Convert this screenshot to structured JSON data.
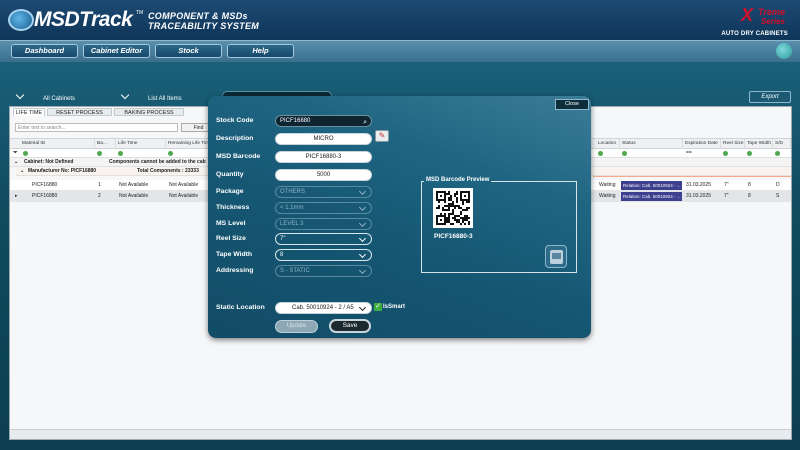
{
  "header": {
    "logo_msd": "MSD",
    "logo_track": "Track",
    "logo_tm": "TM",
    "subtitle_line1": "COMPONENT & MSDs",
    "subtitle_line2": "TRACEABILITY SYSTEM",
    "brand_x": "X",
    "brand_treme": "Treme",
    "brand_series": "Series",
    "brand_tagline": "AUTO DRY CABINETS"
  },
  "nav": {
    "items": [
      "Dashboard",
      "Cabinet Editor",
      "Stock",
      "Help"
    ]
  },
  "toolbar": {
    "all_cabinets": "All Cabinets",
    "list_all_items": "List All Items",
    "export": "Export"
  },
  "grid": {
    "tabs": [
      "LIFE TIME",
      "RESET PROCESS",
      "BAKING PROCESS"
    ],
    "filter_placeholder": "Enter text to search...",
    "find": "Find",
    "columns": [
      "Material ID",
      "Ba...",
      "Life Time",
      "Remaining Life Time",
      "Location",
      "Status",
      "Expiration Date",
      "Reel Size",
      "Tape Width",
      "S/D"
    ],
    "group1": {
      "label": "Cabinet: Not Defined",
      "note": "Components cannot be added to the cab"
    },
    "group2": {
      "label": "Manufacturer No: PICF16880",
      "total": "Total Components : 23333"
    },
    "rows": [
      {
        "material": "PICF16880",
        "ba": "1",
        "life": "Not Available",
        "remaining": "Not Available",
        "location": "Waiting",
        "status": "Relation: Cab. 50010924 - ...",
        "exp": "31.03.2025",
        "reel": "7\"",
        "tape": "8",
        "sd": "D"
      },
      {
        "material": "PICF16880",
        "ba": "2",
        "life": "Not Available",
        "remaining": "Not Available",
        "location": "Waiting",
        "status": "Relation: Cab. 50010924 - ...",
        "exp": "31.03.2025",
        "reel": "7\"",
        "tape": "8",
        "sd": "S"
      }
    ],
    "filter_exp": "=="
  },
  "modal": {
    "close": "Close",
    "labels": {
      "stock_code": "Stock Code",
      "description": "Description",
      "msd_barcode": "MSD Barcode",
      "quantity": "Quantity",
      "package": "Package",
      "thickness": "Thickness",
      "ms_level": "MS Level",
      "reel_size": "Reel Size",
      "tape_width": "Tape Width",
      "addressing": "Addressing",
      "static_location": "Static Location"
    },
    "values": {
      "stock_code": "PICF16880",
      "description": "MICRO",
      "msd_barcode": "PICF16880-3",
      "quantity": "5000",
      "package": "OTHERS",
      "thickness": "< 1.1mm",
      "ms_level": "LEVEL 3",
      "reel_size": "7\"",
      "tape_width": "8",
      "addressing": "S - STATIC",
      "static_location": "Cab. 50010924 - 2 / A5"
    },
    "preview_title": "MSD Barcode Preview",
    "qr_caption": "PICF16880-3",
    "is_smart": "IsSmart",
    "update": "Update",
    "save": "Save"
  }
}
